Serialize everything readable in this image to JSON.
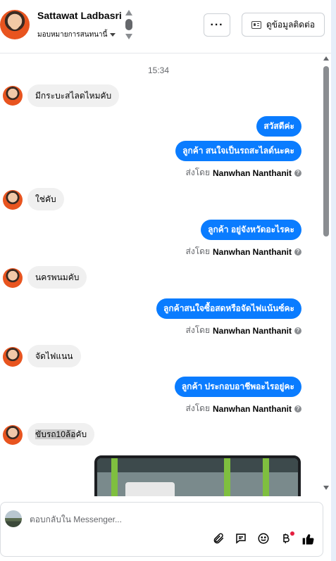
{
  "header": {
    "name": "Sattawat Ladbasri",
    "assign_label": "มอบหมายการสนทนานี้",
    "more_label": "···",
    "contact_label": "ดูข้อมูลติดต่อ"
  },
  "chat": {
    "timestamp": "15:34",
    "messages": [
      {
        "dir": "in",
        "text": "มีกระบะสไลดไหมคับ"
      },
      {
        "dir": "out",
        "text": "สวัสดีค่ะ"
      },
      {
        "dir": "out",
        "text": "ลูกค้า สนใจเป็นรถสะไลด์นะคะ"
      },
      {
        "dir": "in",
        "text": "ใช่คับ"
      },
      {
        "dir": "out",
        "text": "ลูกค้า อยู่จังหวัดอะไรคะ"
      },
      {
        "dir": "in",
        "text": "นครพนมคับ"
      },
      {
        "dir": "out",
        "text": "ลูกค้าสนใจซื้อสดหรือจัดไฟแน้นซ์คะ"
      },
      {
        "dir": "in",
        "text": "จัดไฟแนน"
      },
      {
        "dir": "out",
        "text": "ลูกค้า ประกอบอาชีพอะไรอยู่คะ"
      },
      {
        "dir": "in",
        "text_highlight_1": "ขับรถ10ล้อ",
        "text_rest": "คับ"
      }
    ],
    "sent_by_prefix": "ส่งโดย",
    "sent_by_name": "Nanwhan Nanthanit",
    "help_glyph": "?"
  },
  "composer": {
    "placeholder": "ตอบกลับใน Messenger...",
    "icons": [
      "paperclip-icon",
      "chat-icon",
      "emoji-icon",
      "baht-icon",
      "thumbs-up-icon"
    ]
  },
  "colors": {
    "outgoing_bubble": "#0a7cff",
    "incoming_bubble": "#f0f0f0",
    "notification_dot": "#e41e3f"
  }
}
